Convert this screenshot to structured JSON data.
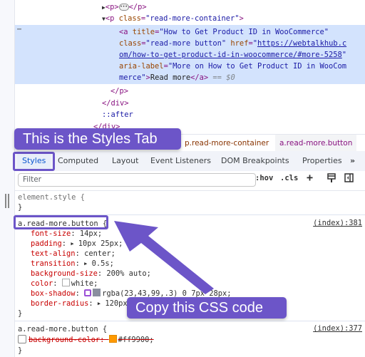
{
  "dom_tree": {
    "line1": {
      "open": "<p>",
      "close": "</p>"
    },
    "line2": {
      "tag_open": "<p ",
      "attr": "class",
      "value": "\"read-more-container\"",
      "tag_close": ">"
    },
    "anchor": {
      "tag": "<a ",
      "title_attr": "title",
      "title_val": "\"How to Get Product ID in WooCommerce\"",
      "class_attr": "class",
      "class_val": "\"read-more button\"",
      "href_attr": "href",
      "href_val_part1": "https://webtalkhub.c",
      "href_val_part2": "om/how-to-get-product-id-in-woocommerce/#more-5258",
      "aria_attr": "aria-label",
      "aria_val_part1": "\"More on How to Get Product ID in WooCom",
      "aria_val_part2": "merce\"",
      "text": "Read more",
      "close": "</a>",
      "eq": "== $0"
    },
    "close_p": "</p>",
    "close_div": "</div>",
    "after": "::after",
    "close_div2": "</div>",
    "row_menu": "⋯"
  },
  "breadcrumb": [
    "p.read-more-container",
    "a.read-more.button"
  ],
  "tabs": [
    "Styles",
    "Computed",
    "Layout",
    "Event Listeners",
    "DOM Breakpoints",
    "Properties",
    "»"
  ],
  "filter": {
    "placeholder": "Filter",
    "hov": ":hov",
    "cls": ".cls"
  },
  "styles": {
    "element_style": "element.style {",
    "close": "}",
    "rule1": {
      "selector": "a.read-more.button",
      "brace": " {",
      "source": "(index):381",
      "props": [
        {
          "name": "font-size",
          "value": "14px;"
        },
        {
          "name": "padding",
          "value": "10px 25px;"
        },
        {
          "name": "text-align",
          "value": "center;"
        },
        {
          "name": "transition",
          "value": "0.5s;"
        },
        {
          "name": "background-size",
          "value": "200% auto;"
        },
        {
          "name": "color",
          "value": "white;"
        },
        {
          "name": "box-shadow",
          "value": "rgba(23,43,99,.3) 0 7px 28px;"
        },
        {
          "name": "border-radius",
          "value": "120px;"
        }
      ]
    },
    "rule2": {
      "selector": "a.read-more.button {",
      "source": "(index):377",
      "prop": {
        "name": "background-color",
        "value": "#ff9900;"
      },
      "swatch_color": "#ff9900"
    }
  },
  "annotations": {
    "styles_tab": "This is the Styles Tab",
    "copy_css": "Copy this CSS code",
    "color": "#6c55c8"
  }
}
